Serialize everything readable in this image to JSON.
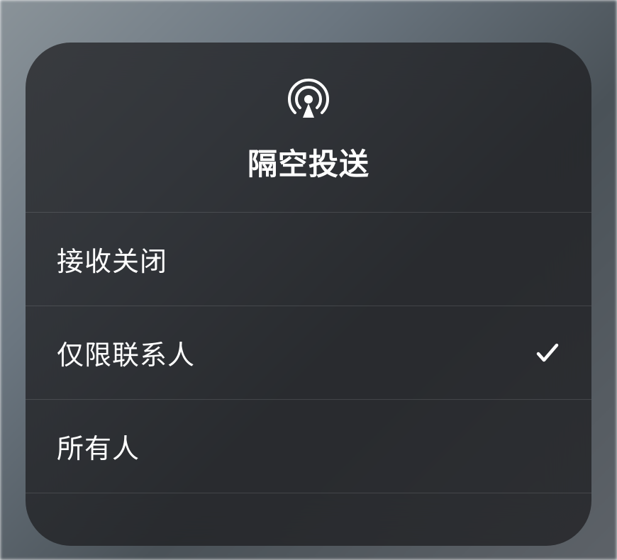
{
  "panel": {
    "title": "隔空投送",
    "icon": "airdrop-icon"
  },
  "options": [
    {
      "label": "接收关闭",
      "selected": false
    },
    {
      "label": "仅限联系人",
      "selected": true
    },
    {
      "label": "所有人",
      "selected": false
    }
  ]
}
